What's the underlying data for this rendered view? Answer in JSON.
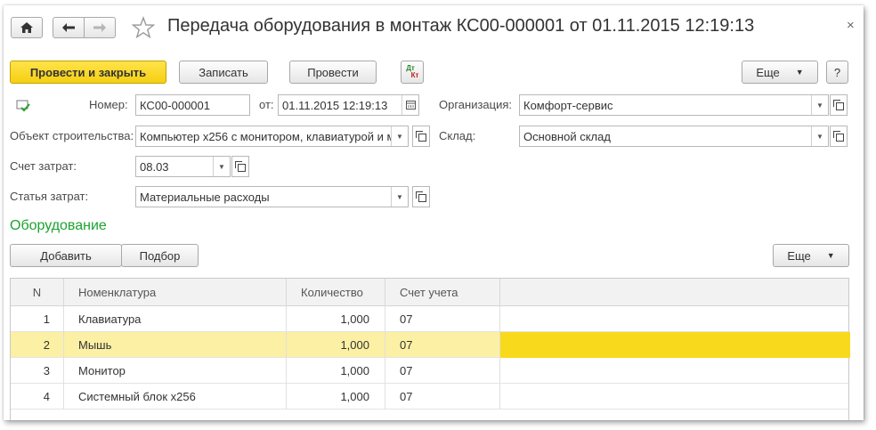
{
  "window": {
    "title": "Передача оборудования в монтаж КС00-000001 от 01.11.2015 12:19:13"
  },
  "icons": {
    "home": "home-icon",
    "back": "arrow-left-icon",
    "forward": "arrow-right-icon",
    "favorite": "star-icon",
    "close": "close-icon",
    "dtkt": "dt-kt-posting-icon",
    "document": "document-status-icon"
  },
  "toolbar": {
    "post_close_label": "Провести и закрыть",
    "save_label": "Записать",
    "post_label": "Провести",
    "dtkt_top": "Дт",
    "dtkt_bottom": "Кт",
    "more_label": "Еще",
    "help_label": "?"
  },
  "form": {
    "number_label": "Номер:",
    "number_value": "КС00-000001",
    "date_label": "от:",
    "date_value": "01.11.2015 12:19:13",
    "organization_label": "Организация:",
    "organization_value": "Комфорт-сервис",
    "object_label": "Объект строительства:",
    "object_value": "Компьютер x256 с монитором, клавиатурой и м",
    "warehouse_label": "Склад:",
    "warehouse_value": "Основной склад",
    "cost_account_label": "Счет затрат:",
    "cost_account_value": "08.03",
    "cost_item_label": "Статья затрат:",
    "cost_item_value": "Материальные расходы"
  },
  "equipment": {
    "section_title": "Оборудование",
    "add_label": "Добавить",
    "pick_label": "Подбор",
    "more_label": "Еще",
    "columns": [
      "N",
      "Номенклатура",
      "Количество",
      "Счет учета"
    ],
    "rows": [
      {
        "n": "1",
        "name": "Клавиатура",
        "qty": "1,000",
        "account": "07"
      },
      {
        "n": "2",
        "name": "Мышь",
        "qty": "1,000",
        "account": "07"
      },
      {
        "n": "3",
        "name": "Монитор",
        "qty": "1,000",
        "account": "07"
      },
      {
        "n": "4",
        "name": "Системный блок x256",
        "qty": "1,000",
        "account": "07"
      }
    ],
    "selected_row": 1
  },
  "colors": {
    "accent_yellow": "#f5cf12",
    "section_green": "#1aa32e",
    "selected_row": "#fbf0a4"
  }
}
